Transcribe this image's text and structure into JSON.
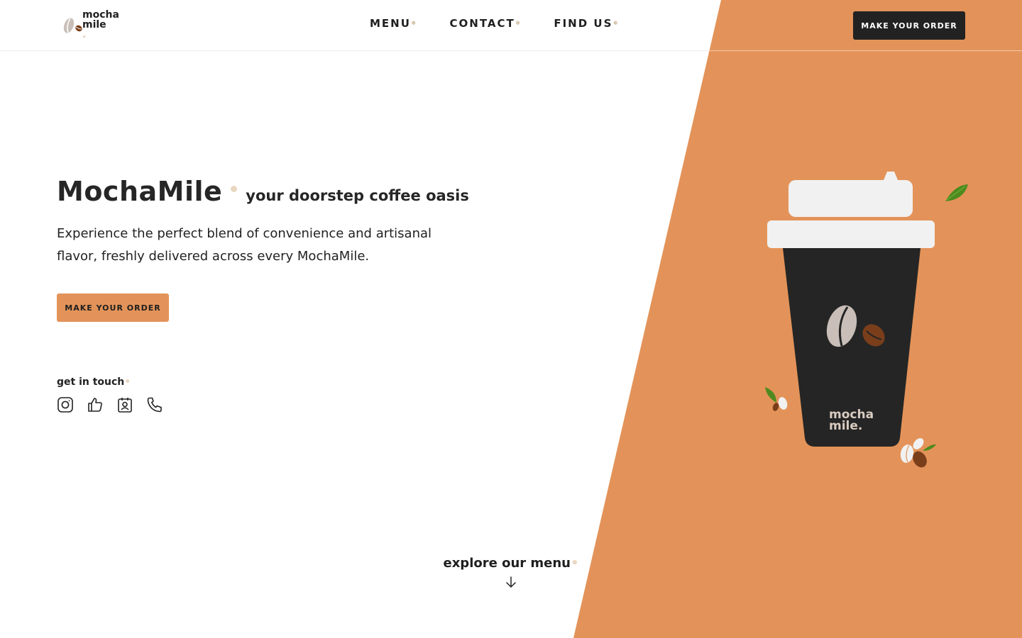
{
  "brand": {
    "logo_line1": "mocha",
    "logo_line2": "mile",
    "logo_dot": ".",
    "cup_line1": "mocha",
    "cup_line2": "mile."
  },
  "nav": {
    "items": [
      {
        "label": "MENU",
        "dot": "•"
      },
      {
        "label": "CONTACT",
        "dot": "•"
      },
      {
        "label": "FIND US",
        "dot": "•"
      }
    ],
    "cta_label": "MAKE YOUR ORDER"
  },
  "hero": {
    "title": "MochaMile",
    "subtitle": "your doorstep coffee oasis",
    "description": "Experience the perfect blend of convenience and artisanal flavor, freshly delivered across every MochaMile.",
    "cta_label": "MAKE YOUR ORDER"
  },
  "contact": {
    "title": "get in touch",
    "dot": "•",
    "icons": [
      "instagram-icon",
      "thumbs-up-icon",
      "contact-card-icon",
      "phone-icon"
    ]
  },
  "explore": {
    "label": "explore our menu",
    "dot": "•"
  },
  "colors": {
    "accent": "#e39359",
    "dark": "#222222",
    "cup_lid": "#f1f1f1",
    "bean_light": "#c9bfb8",
    "bean_dark": "#7a3e1b",
    "leaf": "#4e8a1e",
    "dot": "#ead7c2"
  }
}
